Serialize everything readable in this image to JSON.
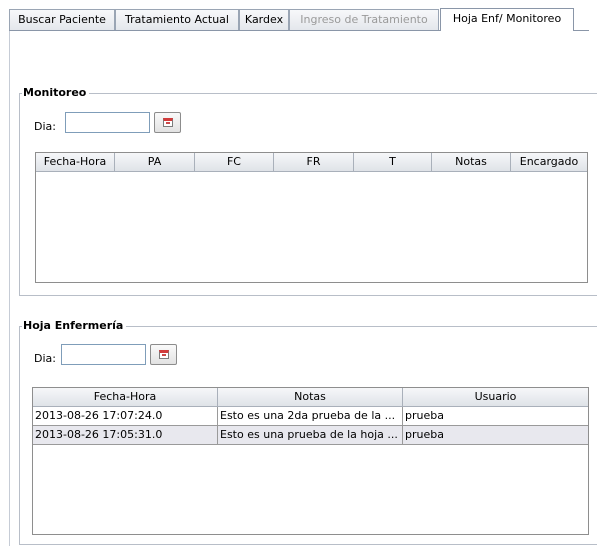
{
  "tabs": [
    {
      "label": "Buscar Paciente",
      "state": "normal"
    },
    {
      "label": "Tratamiento Actual",
      "state": "normal"
    },
    {
      "label": "Kardex",
      "state": "normal"
    },
    {
      "label": "Ingreso de Tratamiento",
      "state": "disabled"
    },
    {
      "label": "Hoja Enf/ Monitoreo",
      "state": "active"
    }
  ],
  "monitoreo": {
    "title": "Monitoreo",
    "dia_label": "Dia:",
    "dia_value": "",
    "columns": [
      "Fecha-Hora",
      "PA",
      "FC",
      "FR",
      "T",
      "Notas",
      "Encargado"
    ],
    "rows": []
  },
  "hoja": {
    "title": "Hoja Enfermería",
    "dia_label": "Dia:",
    "dia_value": "",
    "columns": [
      "Fecha-Hora",
      "Notas",
      "Usuario"
    ],
    "rows": [
      [
        "2013-08-26 17:07:24.0",
        "Esto es una 2da prueba de la ...",
        "prueba"
      ],
      [
        "2013-08-26 17:05:31.0",
        "Esto es una prueba de la hoja ...",
        "prueba"
      ]
    ]
  }
}
